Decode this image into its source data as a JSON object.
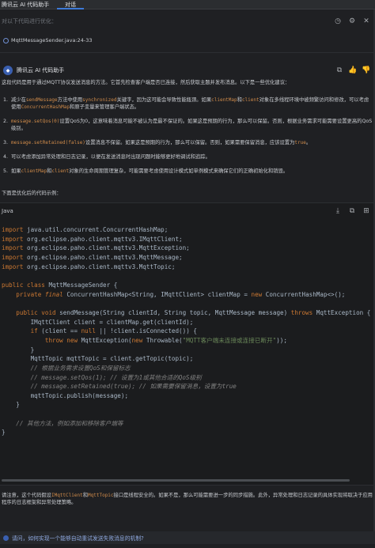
{
  "titlebar": {
    "app_title": "腾讯云 AI 代码助手",
    "tab": "对话"
  },
  "prompt": {
    "placeholder": "对以下代码进行优化："
  },
  "top_icons": [
    "history-icon",
    "settings-icon",
    "close-icon"
  ],
  "file_chip": {
    "label": "MqttMessageSender.java:24-33"
  },
  "assistant": {
    "name": "腾讯云 AI 代码助手"
  },
  "intro": "这段代码是用于通过MQTT协议发送消息的方法。它首先检查客户端是否已连接，然后获取主题并发布消息。以下是一些优化建议：",
  "list": [
    {
      "num": "1.",
      "parts": [
        {
          "t": "减少在"
        },
        {
          "c": "sendMessage"
        },
        {
          "t": "方法中使用"
        },
        {
          "c": "synchronized"
        },
        {
          "t": "关键字，因为这可能会导致性能瓶颈。如果"
        },
        {
          "c": "clientMap"
        },
        {
          "t": "和"
        },
        {
          "c": "client"
        },
        {
          "t": "对象在多线程环境中被频繁访问和修改，可以考虑使用"
        },
        {
          "c": "ConcurrentHashMap"
        },
        {
          "t": "和原子变量来管理客户端状态。"
        }
      ]
    },
    {
      "num": "2.",
      "parts": [
        {
          "c": "message.setQos(0)"
        },
        {
          "t": "设置QoS为0，这意味着消息可能不被认为是最不保证的。如果这是预期的行为，那么可以保留。否则，根据业务需求可能需要设置更高的QoS级别。"
        }
      ]
    },
    {
      "num": "3.",
      "parts": [
        {
          "c": "message.setRetained(false)"
        },
        {
          "t": "设置消息不保留。如果这是预期的行为，那么可以保留。否则，如果需要保留消息，应该设置为"
        },
        {
          "c": "true"
        },
        {
          "t": "。"
        }
      ]
    },
    {
      "num": "4.",
      "parts": [
        {
          "t": "可以考虑添加异常处理和日志记录，以便在发送消息时出现问题时能够更好地调试和追踪。"
        }
      ]
    },
    {
      "num": "5.",
      "parts": [
        {
          "t": "如果"
        },
        {
          "c": "clientMap"
        },
        {
          "t": "和"
        },
        {
          "c": "client"
        },
        {
          "t": "对象的生命周期管理复杂，可能需要考虑使用设计模式如单例模式来确保它们的正确初始化和销毁。"
        }
      ]
    }
  ],
  "after_list": "下面是优化后的代码示例：",
  "code": {
    "lang": "Java",
    "lines": [
      [
        [
          "kw",
          "import"
        ],
        [
          "plain",
          " java.util.concurrent.ConcurrentHashMap;"
        ]
      ],
      [
        [
          "kw",
          "import"
        ],
        [
          "plain",
          " org.eclipse.paho.client.mqttv3.IMqttClient;"
        ]
      ],
      [
        [
          "kw",
          "import"
        ],
        [
          "plain",
          " org.eclipse.paho.client.mqttv3.MqttException;"
        ]
      ],
      [
        [
          "kw",
          "import"
        ],
        [
          "plain",
          " org.eclipse.paho.client.mqttv3.MqttMessage;"
        ]
      ],
      [
        [
          "kw",
          "import"
        ],
        [
          "plain",
          " org.eclipse.paho.client.mqttv3.MqttTopic;"
        ]
      ],
      [
        [
          "plain",
          ""
        ]
      ],
      [
        [
          "kw",
          "public class"
        ],
        [
          "plain",
          " MqttMessageSender {"
        ]
      ],
      [
        [
          "plain",
          "    "
        ],
        [
          "kw",
          "private"
        ],
        [
          "plain",
          " "
        ],
        [
          "kwi",
          "final"
        ],
        [
          "plain",
          " ConcurrentHashMap<String, IMqttClient> clientMap = "
        ],
        [
          "kw",
          "new"
        ],
        [
          "plain",
          " ConcurrentHashMap<>();"
        ]
      ],
      [
        [
          "plain",
          ""
        ]
      ],
      [
        [
          "plain",
          "    "
        ],
        [
          "kw",
          "public void"
        ],
        [
          "plain",
          " sendMessage(String clientId, String topic, MqttMessage message) "
        ],
        [
          "kw",
          "throws"
        ],
        [
          "plain",
          " MqttException {"
        ]
      ],
      [
        [
          "plain",
          "        IMqttClient client = clientMap.get(clientId);"
        ]
      ],
      [
        [
          "plain",
          "        "
        ],
        [
          "kw",
          "if"
        ],
        [
          "plain",
          " (client == "
        ],
        [
          "kw",
          "null"
        ],
        [
          "plain",
          " || !client.isConnected()) {"
        ]
      ],
      [
        [
          "plain",
          "            "
        ],
        [
          "kw",
          "throw new"
        ],
        [
          "plain",
          " MqttException("
        ],
        [
          "kw",
          "new"
        ],
        [
          "plain",
          " Throwable("
        ],
        [
          "str",
          "\"MQTT客户端未连接或连接已断开\""
        ],
        [
          "plain",
          "));"
        ]
      ],
      [
        [
          "plain",
          "        }"
        ]
      ],
      [
        [
          "plain",
          "        MqttTopic mqttTopic = client.getTopic(topic);"
        ]
      ],
      [
        [
          "cm",
          "        // 根据业务需求设置QoS和保留标志"
        ]
      ],
      [
        [
          "cm",
          "        // message.setQos(1); // 设置为1或其他合适的QoS级别"
        ]
      ],
      [
        [
          "cm",
          "        // message.setRetained(true); // 如果需要保留消息，设置为true"
        ]
      ],
      [
        [
          "plain",
          "        mqttTopic.publish(message);"
        ]
      ],
      [
        [
          "plain",
          "    }"
        ]
      ],
      [
        [
          "plain",
          ""
        ]
      ],
      [
        [
          "cm",
          "    // 其他方法，例如添加和移除客户端等"
        ]
      ],
      [
        [
          "plain",
          "}"
        ]
      ]
    ]
  },
  "notes": [
    {
      "t": "请注意，这个代码假设"
    },
    {
      "c": "IMqttClient"
    },
    {
      "t": "和"
    },
    {
      "c": "MqttTopic"
    },
    {
      "t": "接口是线程安全的。如果不是，那么可能需要进一步的同步措施。此外，异常处理和日志记录的具体实现将取决于应用程序的日志框架和异常处理策略。"
    }
  ],
  "suggestion": "请问，如何实现一个能够自动重试发送失败消息的机制?",
  "colors": {
    "accent": "#3d7bd9",
    "inline_code": "#d08b4a",
    "keyword": "#cc7832",
    "string": "#6a8759",
    "comment": "#808080"
  }
}
